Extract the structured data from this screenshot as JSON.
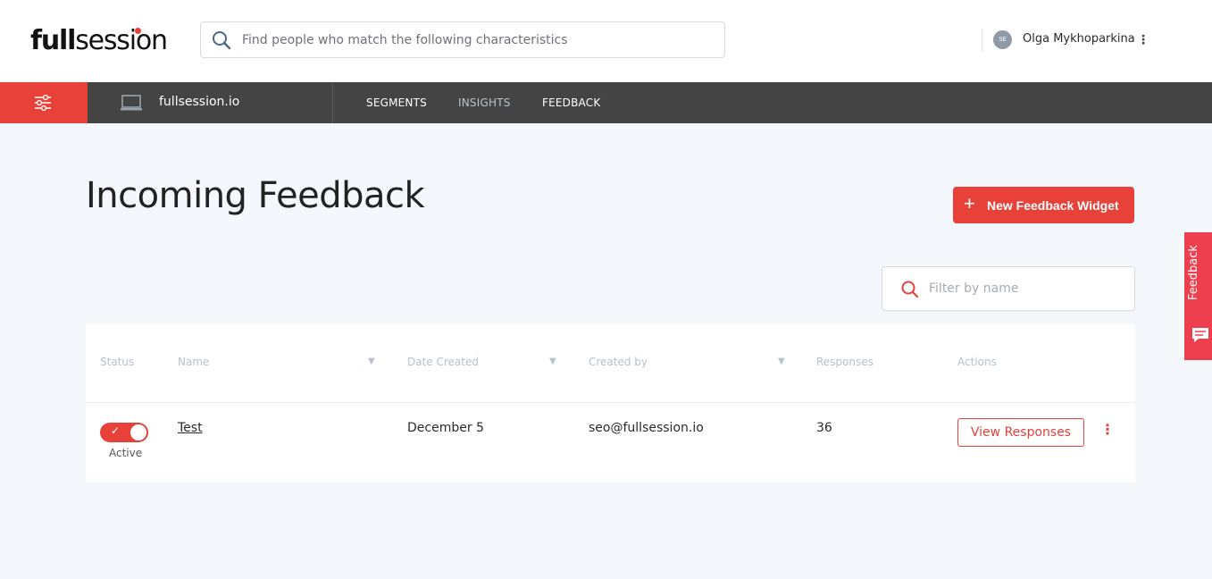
{
  "header": {
    "logo_text_a": "full",
    "logo_text_b": "session",
    "search_placeholder": "Find people who match the following characteristics",
    "avatar_initials": "SE",
    "user_name": "Olga Mykhoparkina"
  },
  "nav": {
    "site_name": "fullsession.io",
    "links": [
      "SEGMENTS",
      "INSIGHTS",
      "FEEDBACK"
    ]
  },
  "page": {
    "title": "Incoming Feedback",
    "new_button_label": "New Feedback Widget",
    "filter_placeholder": "Filter by name"
  },
  "table": {
    "headers": [
      "Status",
      "Name",
      "Date Created",
      "Created by",
      "Responses",
      "Actions"
    ],
    "rows": [
      {
        "status": "Active",
        "name": "Test",
        "date_created": "December 5",
        "created_by": "seo@fullsession.io",
        "responses": "36",
        "action_label": "View Responses"
      }
    ]
  },
  "side_tab": {
    "label": "Feedback"
  },
  "colors": {
    "accent": "#e8413a",
    "navbar": "#444444",
    "background": "#f4f8fc"
  }
}
